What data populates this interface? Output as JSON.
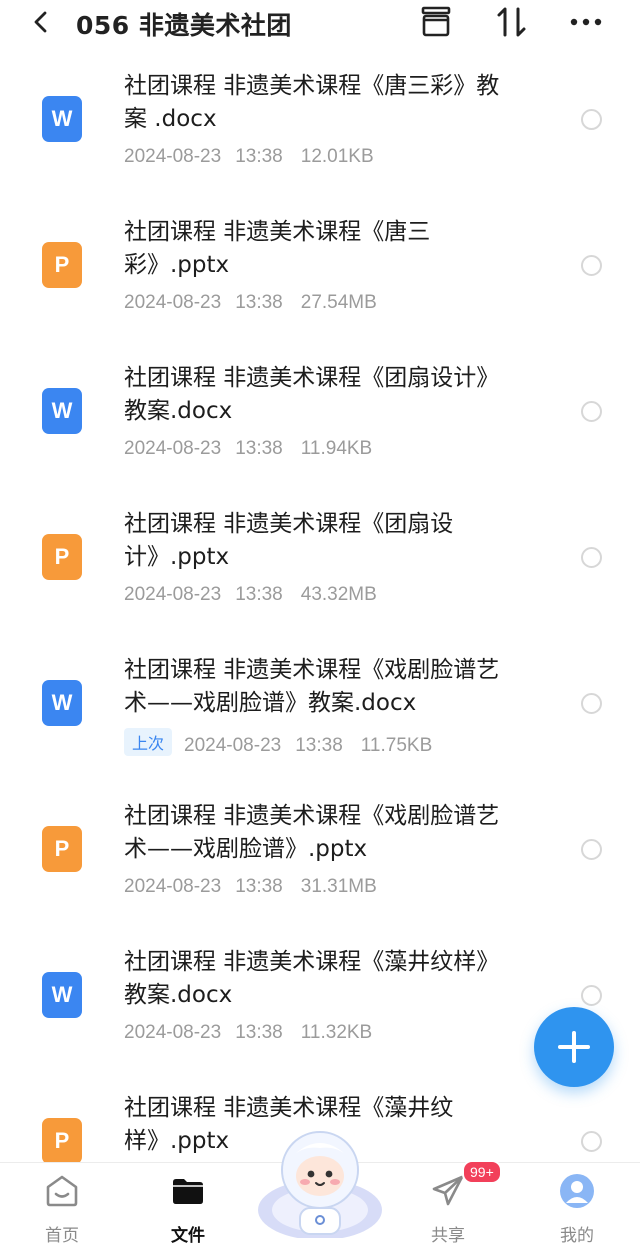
{
  "header": {
    "title": "056 非遗美术社团",
    "back_icon": "back-chevron-icon",
    "icons": [
      "archive-icon",
      "sort-icon",
      "more-icon"
    ]
  },
  "colors": {
    "word": "#3b86f1",
    "ppt": "#f79a3a",
    "fab": "#2f94ef",
    "badge_bg": "#e8f3fd",
    "badge_text": "#3a86f0",
    "notification": "#f2405a"
  },
  "files": [
    {
      "type": "W",
      "line1": "社团课程 非遗美术课程《唐三彩》教",
      "line2": "案 .docx",
      "date": "2024-08-23",
      "time": "13:38",
      "size": "12.01KB",
      "badge": ""
    },
    {
      "type": "P",
      "line1": "社团课程 非遗美术课程《唐三",
      "line2": "彩》.pptx",
      "date": "2024-08-23",
      "time": "13:38",
      "size": "27.54MB",
      "badge": ""
    },
    {
      "type": "W",
      "line1": "社团课程 非遗美术课程《团扇设计》",
      "line2": "教案.docx",
      "date": "2024-08-23",
      "time": "13:38",
      "size": "11.94KB",
      "badge": ""
    },
    {
      "type": "P",
      "line1": "社团课程 非遗美术课程《团扇设",
      "line2": "计》.pptx",
      "date": "2024-08-23",
      "time": "13:38",
      "size": "43.32MB",
      "badge": ""
    },
    {
      "type": "W",
      "line1": "社团课程 非遗美术课程《戏剧脸谱艺",
      "line2": "术——戏剧脸谱》教案.docx",
      "date": "2024-08-23",
      "time": "13:38",
      "size": "11.75KB",
      "badge": "上次"
    },
    {
      "type": "P",
      "line1": "社团课程 非遗美术课程《戏剧脸谱艺",
      "line2": "术——戏剧脸谱》.pptx",
      "date": "2024-08-23",
      "time": "13:38",
      "size": "31.31MB",
      "badge": ""
    },
    {
      "type": "W",
      "line1": "社团课程 非遗美术课程《藻井纹样》",
      "line2": "教案.docx",
      "date": "2024-08-23",
      "time": "13:38",
      "size": "11.32KB",
      "badge": ""
    },
    {
      "type": "P",
      "line1": "社团课程 非遗美术课程《藻井纹",
      "line2": "样》.pptx",
      "date": "",
      "time": "",
      "size": "",
      "badge": ""
    }
  ],
  "tabs": [
    {
      "label": "首页",
      "icon": "home-icon",
      "active": false
    },
    {
      "label": "文件",
      "icon": "folder-icon",
      "active": true
    },
    {
      "label": "",
      "icon": "mascot-icon",
      "active": false
    },
    {
      "label": "共享",
      "icon": "share-icon",
      "active": false
    },
    {
      "label": "我的",
      "icon": "profile-icon",
      "active": false
    }
  ],
  "share_badge": "99+"
}
